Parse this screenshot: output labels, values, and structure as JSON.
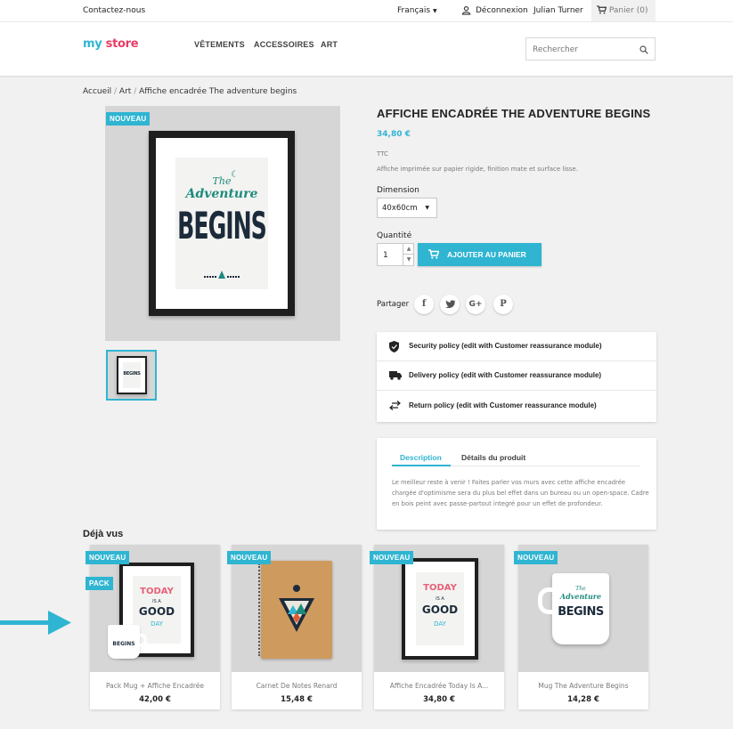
{
  "topbar": {
    "contact": "Contactez-nous",
    "language": "Français",
    "login": "Déconnexion",
    "user": "Julian Turner",
    "cart": "Panier (0)"
  },
  "header": {
    "logo_part1": "my",
    "logo_part2": "store",
    "nav": [
      "VÊTEMENTS",
      "ACCESSOIRES",
      "ART"
    ],
    "search_placeholder": "Rechercher"
  },
  "breadcrumb": [
    "Accueil",
    "Art",
    "Affiche encadrée The adventure begins"
  ],
  "product": {
    "badge": "NOUVEAU",
    "title": "AFFICHE ENCADRÉE THE ADVENTURE BEGINS",
    "price": "34,80 €",
    "tax": "TTC",
    "short_desc": "Affiche imprimée sur papier rigide, finition mate et surface lisse.",
    "dimension_label": "Dimension",
    "dimension_value": "40x60cm",
    "quantity_label": "Quantité",
    "quantity_value": "1",
    "add_to_cart": "AJOUTER AU PANIER",
    "share_label": "Partager",
    "poster": {
      "line1": "The",
      "line2": "Adventure",
      "line3": "BEGINS"
    }
  },
  "reassurance": [
    "Security policy (edit with Customer reassurance module)",
    "Delivery policy (edit with Customer reassurance module)",
    "Return policy (edit with Customer reassurance module)"
  ],
  "tabs": {
    "description": "Description",
    "details": "Détails du produit",
    "text": "Le meilleur reste à venir ! Faites parler vos murs avec cette affiche encadrée chargée d'optimisme sera du plus bel effet dans un bureau ou un open-space. Cadre en bois peint avec passe-partout integré pour un effet de profondeur."
  },
  "seen": {
    "title": "Déjà vus",
    "products": [
      {
        "name": "Pack Mug + Affiche Encadrée",
        "price": "42,00 €",
        "badges": [
          "NOUVEAU",
          "PACK"
        ]
      },
      {
        "name": "Carnet De Notes Renard",
        "price": "15,48 €",
        "badges": [
          "NOUVEAU"
        ]
      },
      {
        "name": "Affiche Encadrée Today Is A...",
        "price": "34,80 €",
        "badges": [
          "NOUVEAU"
        ]
      },
      {
        "name": "Mug The Adventure Begins",
        "price": "14,28 €",
        "badges": [
          "NOUVEAU"
        ]
      }
    ]
  },
  "poster_today": {
    "line1": "TODAY",
    "line2": "IS A",
    "line3": "GOOD",
    "line4": "DAY"
  },
  "colors": {
    "accent": "#2fb5d2",
    "teal": "#1e8b7e",
    "navy": "#1c2b3a",
    "pink": "#e8607a"
  }
}
